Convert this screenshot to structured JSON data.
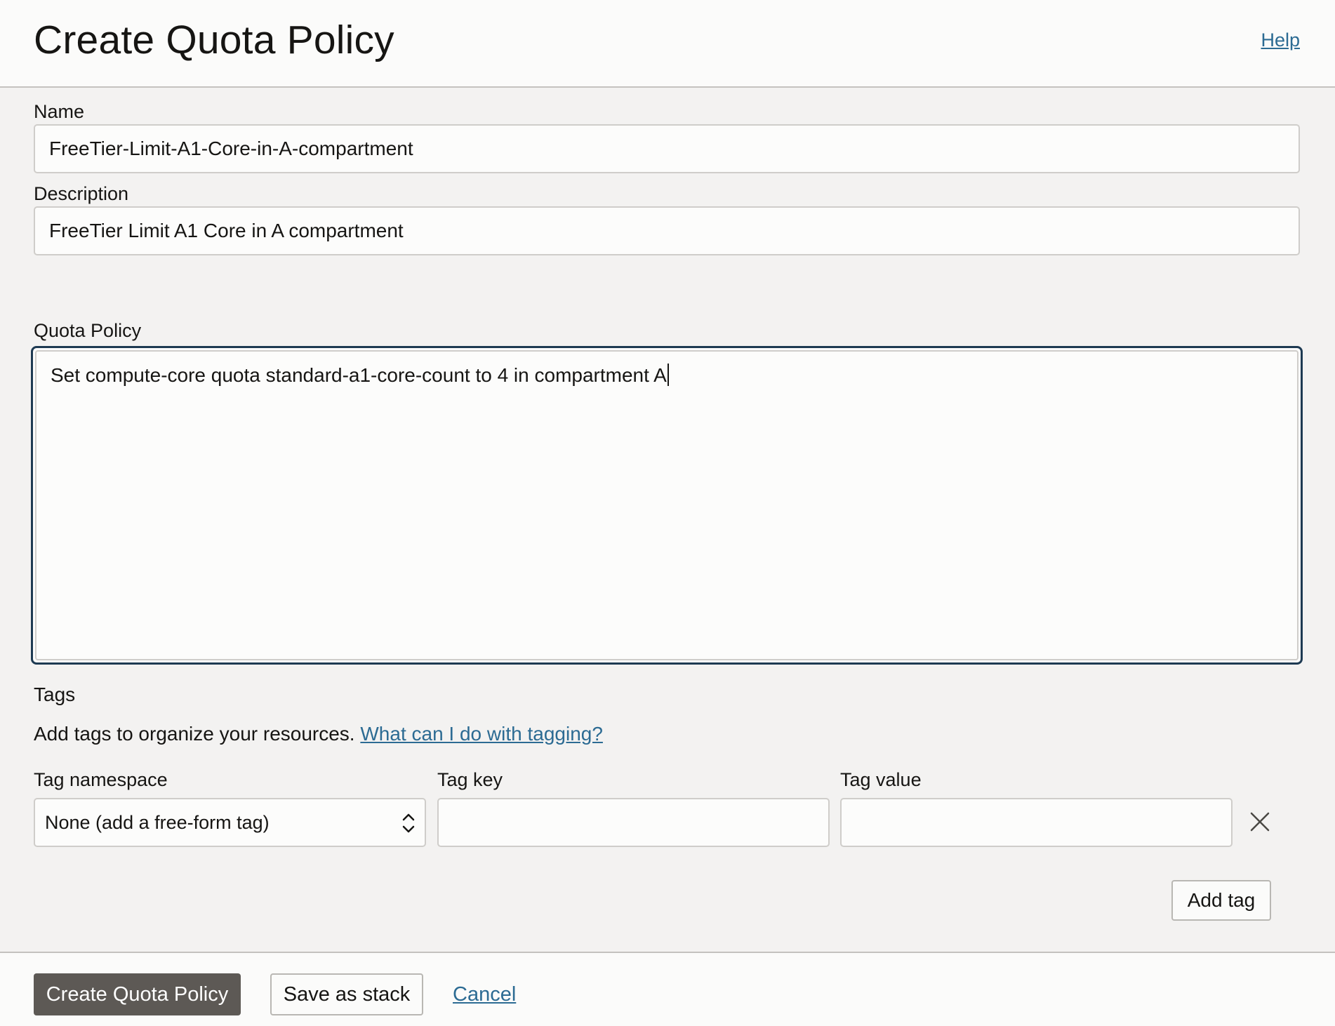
{
  "header": {
    "title": "Create Quota Policy",
    "help_label": "Help"
  },
  "form": {
    "name": {
      "label": "Name",
      "value": "FreeTier-Limit-A1-Core-in-A-compartment"
    },
    "description": {
      "label": "Description",
      "value": "FreeTier Limit A1 Core in A compartment"
    },
    "quota_policy": {
      "label": "Quota Policy",
      "value": "Set compute-core quota standard-a1-core-count to 4 in compartment A",
      "focused": true
    },
    "tags": {
      "heading": "Tags",
      "description": "Add tags to organize your resources.",
      "help_link": "What can I do with tagging?",
      "namespace_label": "Tag namespace",
      "namespace_value": "None (add a free-form tag)",
      "key_label": "Tag key",
      "key_value": "",
      "value_label": "Tag value",
      "value_value": "",
      "remove_icon": "close-icon",
      "add_tag_label": "Add tag"
    }
  },
  "footer": {
    "create_label": "Create Quota Policy",
    "save_stack_label": "Save as stack",
    "cancel_label": "Cancel"
  },
  "colors": {
    "primary_button": "#5d5955",
    "link": "#2c6b93",
    "focus_border": "#1d3a52",
    "background": "#f3f2f1"
  }
}
